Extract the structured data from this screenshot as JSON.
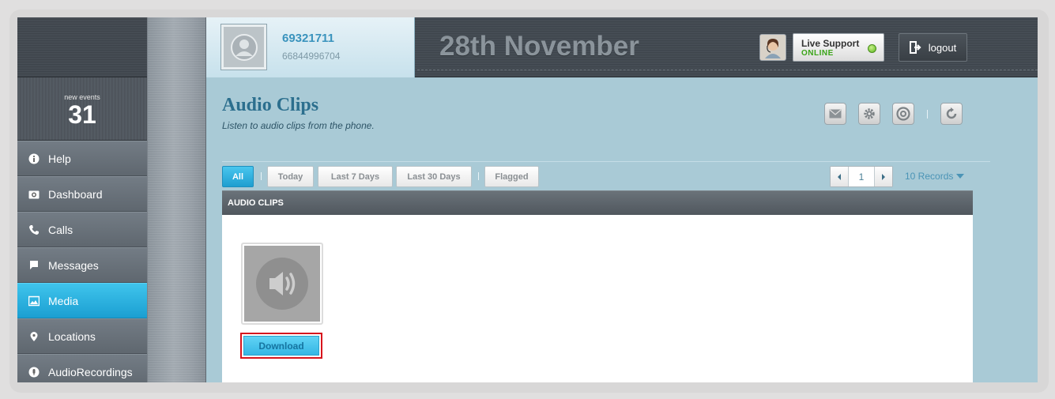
{
  "sidebar": {
    "events_label": "new events",
    "events_count": "31",
    "items": [
      {
        "label": "Help",
        "icon": "info-icon"
      },
      {
        "label": "Dashboard",
        "icon": "camera-icon"
      },
      {
        "label": "Calls",
        "icon": "phone-icon"
      },
      {
        "label": "Messages",
        "icon": "message-icon"
      },
      {
        "label": "Media",
        "icon": "image-icon",
        "active": true
      },
      {
        "label": "Locations",
        "icon": "location-pin-icon"
      },
      {
        "label": "AudioRecordings",
        "icon": "microphone-icon"
      }
    ]
  },
  "header": {
    "profile_name": "69321711",
    "profile_number": "66844996704",
    "date": "28th November",
    "support_title": "Live Support",
    "support_status": "ONLINE",
    "logout_label": "logout"
  },
  "page": {
    "title": "Audio Clips",
    "subtitle": "Listen to audio clips from the phone.",
    "filters": [
      "All",
      "Today",
      "Last 7 Days",
      "Last 30 Days",
      "Flagged"
    ],
    "active_filter": "All",
    "page_number": "1",
    "records_label": "10 Records",
    "section_title": "AUDIO CLIPS",
    "clip": {
      "icon": "speaker-icon",
      "download_label": "Download"
    }
  },
  "colors": {
    "accent": "#1e9ed0",
    "content_bg": "#a9cad6",
    "sidebar": "#6f7780",
    "highlight_border": "#d7141d"
  }
}
